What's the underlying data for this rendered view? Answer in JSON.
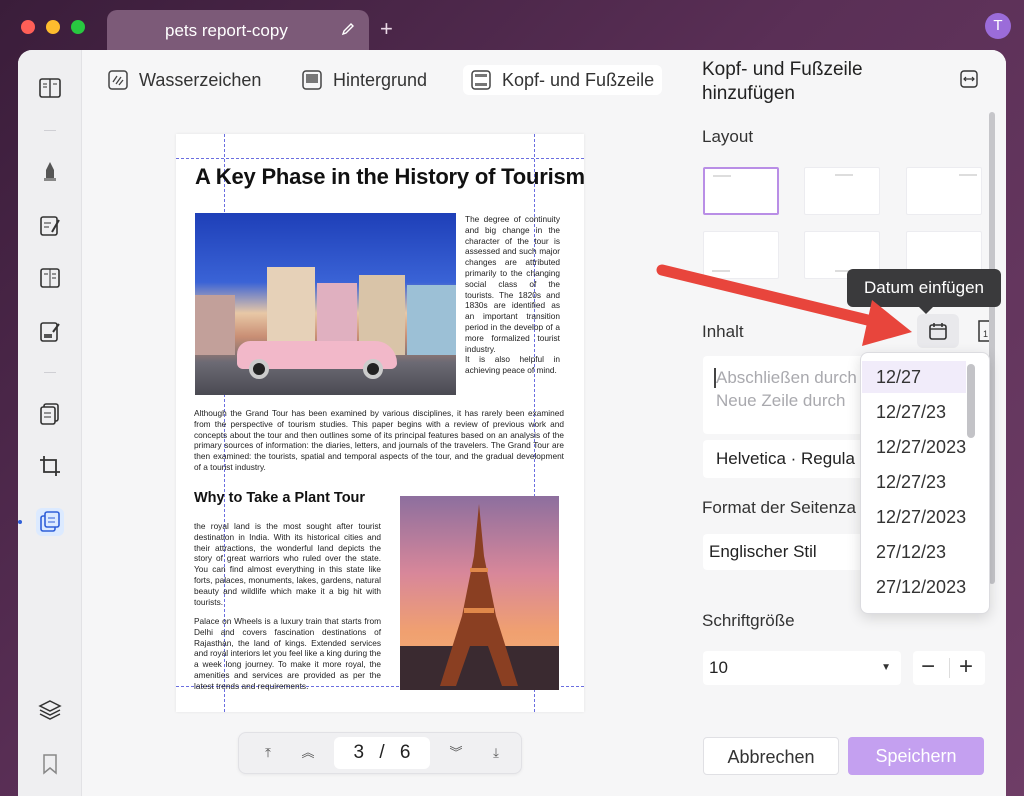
{
  "tab": {
    "title": "pets report-copy"
  },
  "user": {
    "initial": "T"
  },
  "toolbar": [
    {
      "label": "Wasserzeichen",
      "icon": "watermark-icon"
    },
    {
      "label": "Hintergrund",
      "icon": "background-icon"
    },
    {
      "label": "Kopf- und Fußzeile",
      "icon": "header-footer-icon"
    }
  ],
  "document": {
    "title": "A Key Phase in the History of Tourism",
    "para1": "The degree of continuity and big change in the character of the tour is assessed and such major changes are attributed primarily to the changing social class of the tourists. The 1820s and 1830s are identified as an important transition period in the develop of a more formalized tourist industry.\nIt is also helpful in achieving peace of mind.",
    "para2": "Although the Grand Tour has been examined by various disciplines, it has rarely been examined from the perspective of tourism studies. This paper begins with a review of previous work and concepts about the tour and then outlines some of its principal features based on an analysis of the primary sources of information: the diaries, letters, and journals of the travelers. The Grand Tour are then examined: the tourists, spatial and temporal aspects of the tour, and the gradual development of a tourist industry.",
    "heading2": "Why to Take a Plant Tour",
    "para3": "the royal land is the most sought after tourist destination in India. With its historical cities and their attractions, the wonderful land depicts the story of great warriors who ruled over the state. You can find almost everything in this state like forts, palaces, monuments, lakes, gardens, natural beauty and wildlife which make it a big hit with tourists.",
    "para4": "Palace on Wheels is a luxury train that starts from Delhi and covers fascination destinations of Rajasthan, the land of kings. Extended services and royal interiors let you feel like a king during the a week long journey. To make it more royal, the amenities and services are provided as per the latest trends and requirements."
  },
  "pager": {
    "current": "3",
    "separator": "/",
    "total": "6"
  },
  "panel": {
    "title": "Kopf- und Fußzeile hinzufügen",
    "layout_label": "Layout",
    "content_label": "Inhalt",
    "content_placeholder_line1": "Abschließen durch",
    "content_placeholder_line2": "Neue Zeile durch",
    "font_value": "Helvetica · Regula",
    "page_format_label": "Format der Seitenza",
    "page_format_value": "Englischer Stil",
    "font_size_label": "Schriftgröße",
    "font_size_value": "10",
    "minus": "−",
    "plus": "+",
    "cancel_label": "Abbrechen",
    "save_label": "Speichern"
  },
  "tooltip": {
    "text": "Datum einfügen"
  },
  "date_formats": [
    "12/27",
    "12/27/23",
    "12/27/2023",
    "12/27/23",
    "12/27/2023",
    "27/12/23",
    "27/12/2023"
  ],
  "colors": {
    "accent": "#c4a0f0",
    "arrow": "#e8453c",
    "guide": "#6a6ee0"
  }
}
